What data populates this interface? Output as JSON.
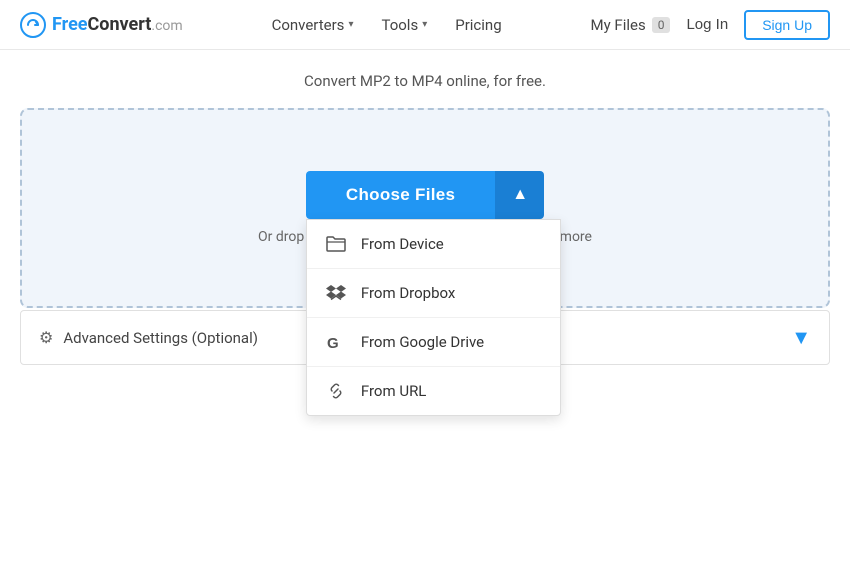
{
  "header": {
    "logo": {
      "free": "Free",
      "convert": "Convert",
      "domain": ".com"
    },
    "nav": [
      {
        "label": "Converters",
        "has_dropdown": true
      },
      {
        "label": "Tools",
        "has_dropdown": true
      },
      {
        "label": "Pricing",
        "has_dropdown": false
      }
    ],
    "my_files_label": "My Files",
    "files_count": "0",
    "login_label": "Log In",
    "signup_label": "Sign Up"
  },
  "main": {
    "subtitle": "Convert MP2 to MP4 online, for free.",
    "drop_zone": {
      "or_drop_text": "Or drop files here. Max file size 1 GB.",
      "for_more": "for more"
    },
    "choose_files": {
      "label": "Choose Files"
    },
    "dropdown": {
      "items": [
        {
          "id": "device",
          "label": "From Device",
          "icon": "folder"
        },
        {
          "id": "dropbox",
          "label": "From Dropbox",
          "icon": "dropbox"
        },
        {
          "id": "google_drive",
          "label": "From Google Drive",
          "icon": "google"
        },
        {
          "id": "url",
          "label": "From URL",
          "icon": "link"
        }
      ]
    },
    "advanced_settings": {
      "label": "Advanced Settings (Optional)"
    }
  },
  "colors": {
    "primary": "#2196f3",
    "primary_dark": "#1a7fd4",
    "bg_light": "#f0f5fb",
    "border": "#b0c4d8"
  }
}
